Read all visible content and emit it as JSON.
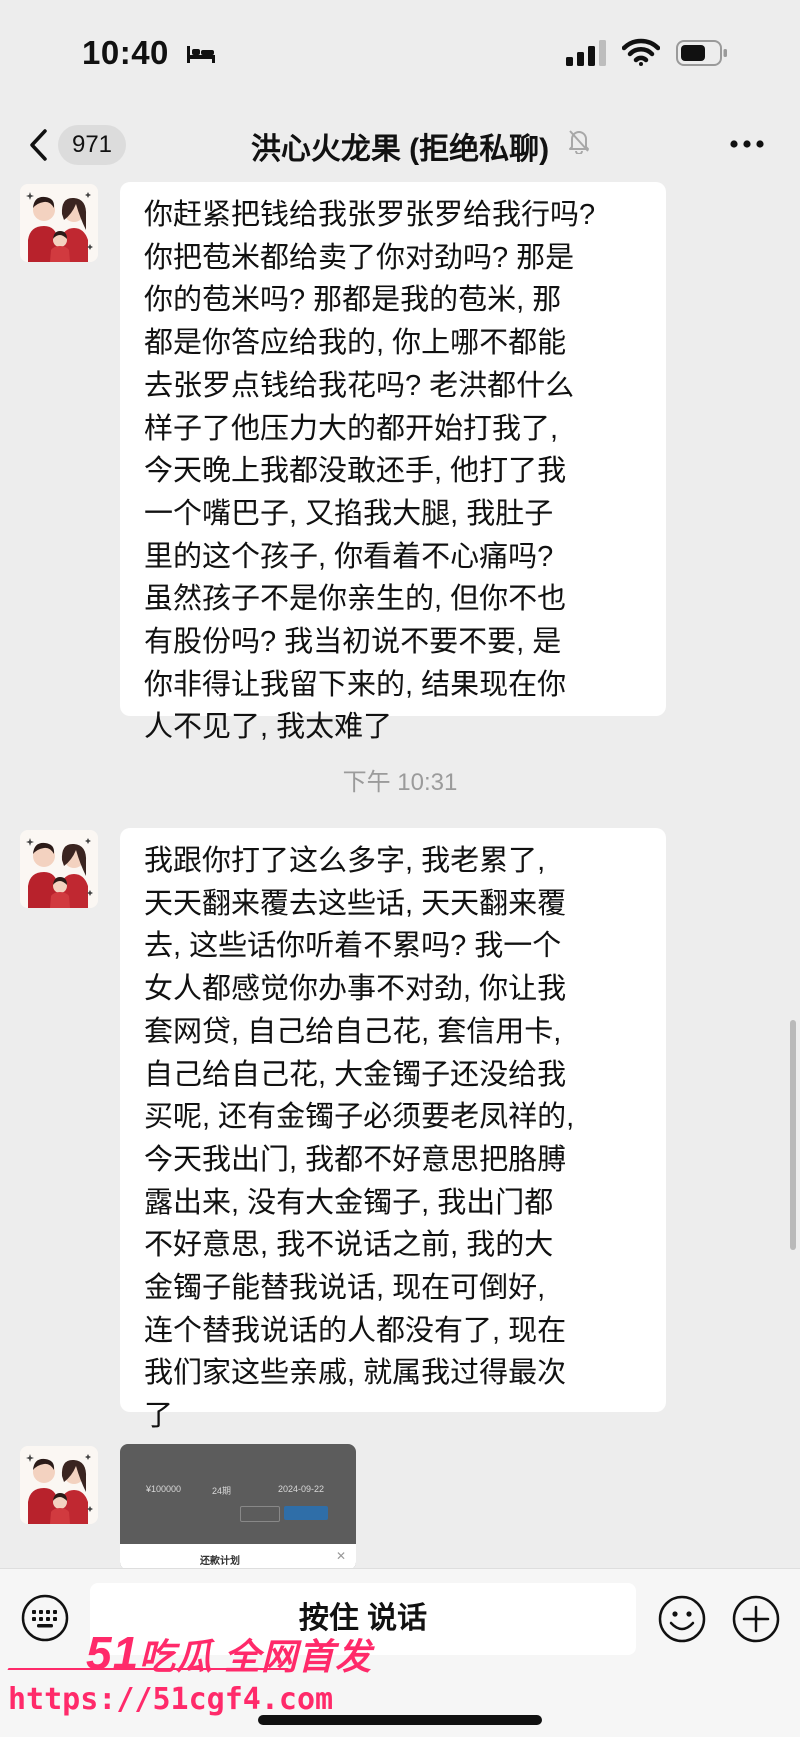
{
  "status_bar": {
    "time": "10:40"
  },
  "header": {
    "unread_count": "971",
    "title": "洪心火龙果 (拒绝私聊)"
  },
  "messages": [
    {
      "type": "text",
      "text": "你赶紧把钱给我张罗张罗给我行吗?\n你把苞米都给卖了你对劲吗? 那是\n你的苞米吗? 那都是我的苞米, 那\n都是你答应给我的, 你上哪不都能\n去张罗点钱给我花吗? 老洪都什么\n样子了他压力大的都开始打我了,\n今天晚上我都没敢还手, 他打了我\n一个嘴巴子, 又掐我大腿, 我肚子\n里的这个孩子, 你看着不心痛吗?\n虽然孩子不是你亲生的, 但你不也\n有股份吗? 我当初说不要不要, 是\n你非得让我留下来的, 结果现在你\n人不见了, 我太难了"
    },
    {
      "type": "timestamp",
      "text": "下午 10:31"
    },
    {
      "type": "text",
      "text": "我跟你打了这么多字, 我老累了,\n天天翻来覆去这些话, 天天翻来覆\n去, 这些话你听着不累吗? 我一个\n女人都感觉你办事不对劲, 你让我\n套网贷, 自己给自己花, 套信用卡,\n自己给自己花, 大金镯子还没给我\n买呢, 还有金镯子必须要老凤祥的,\n今天我出门, 我都不好意思把胳膊\n露出来, 没有大金镯子, 我出门都\n不好意思, 我不说话之前, 我的大\n金镯子能替我说话, 现在可倒好,\n连个替我说话的人都没有了, 现在\n我们家这些亲戚, 就属我过得最次\n了"
    },
    {
      "type": "image",
      "amount": "¥100000",
      "periods": "24期",
      "date": "2024-09-22",
      "sheet_title": "还款计划"
    }
  ],
  "input_bar": {
    "hold_to_talk_label": "按住 说话"
  },
  "watermark": {
    "brand_51": "51",
    "brand_rest": "吃瓜 全网首发",
    "url": "https://51cgf4.com"
  },
  "colors": {
    "background": "#ededed",
    "bubble": "#ffffff",
    "watermark": "#ff2a6a"
  }
}
